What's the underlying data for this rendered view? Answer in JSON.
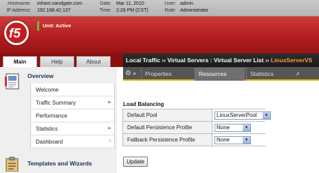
{
  "topbar": {
    "hostname_label": "Hostname:",
    "hostname": "infrant.nandgate.com",
    "ip_label": "IP Address:",
    "ip": "192.168.42.137",
    "date_label": "Date:",
    "date": "Mar 11, 2010",
    "time_label": "Time:",
    "time": "2:28 PM (CST)",
    "user_label": "User:",
    "user": "admin",
    "role_label": "Role:",
    "role": "Administrator"
  },
  "banner": {
    "unit_status": "Unit: Active"
  },
  "main_tabs": [
    {
      "label": "Main"
    },
    {
      "label": "Help"
    },
    {
      "label": "About"
    }
  ],
  "sidebar": {
    "overview_title": "Overview",
    "items": [
      {
        "label": "Welcome"
      },
      {
        "label": "Traffic Summary"
      },
      {
        "label": "Performance"
      },
      {
        "label": "Statistics"
      },
      {
        "label": "Dashboard"
      }
    ],
    "templates_title": "Templates and Wizards"
  },
  "breadcrumb": {
    "part1": "Local Traffic",
    "sep": " ›› ",
    "part2": "Virtual Servers : Virtual Server List",
    "current": "LinuxServerVS"
  },
  "subtabs": [
    {
      "label": "Properties"
    },
    {
      "label": "Resources"
    },
    {
      "label": "Statistics"
    }
  ],
  "form": {
    "section_title": "Load Balancing",
    "rows": [
      {
        "label": "Default Pool",
        "value": "LinuxServerPool"
      },
      {
        "label": "Default Persistence Profile",
        "value": "None"
      },
      {
        "label": "Fallback Persistence Profile",
        "value": "None"
      }
    ],
    "update_label": "Update"
  },
  "colors": {
    "brand_red": "#b11e1e",
    "accent_orange": "#f4a23a",
    "active_green": "#5fbf3a"
  }
}
